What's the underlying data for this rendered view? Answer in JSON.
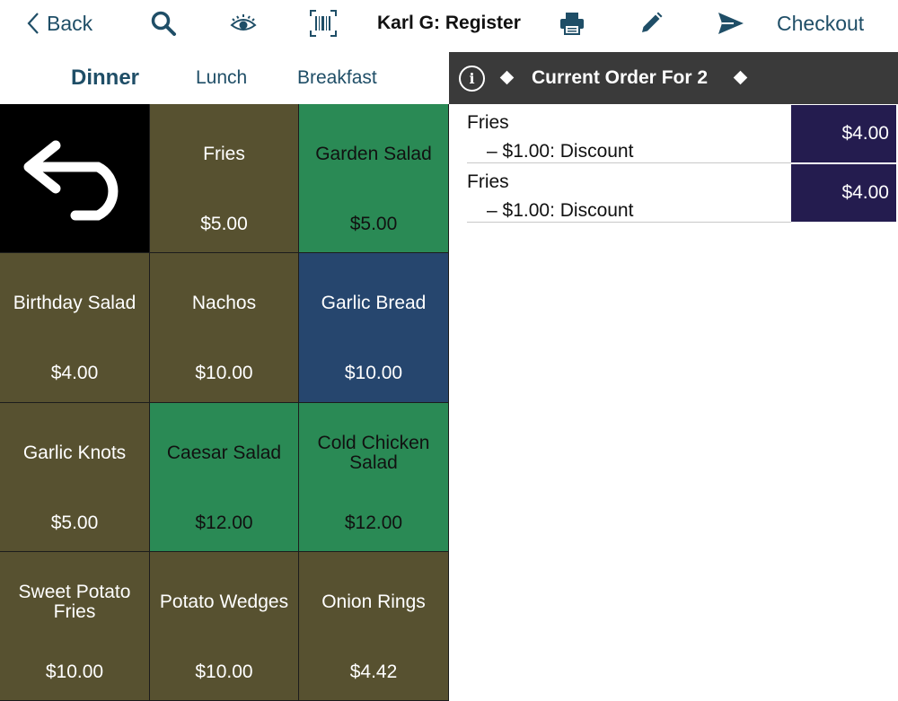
{
  "toolbar": {
    "back_label": "Back",
    "title": "Karl G: Register",
    "checkout_label": "Checkout",
    "icons": [
      "search-icon",
      "eye-icon",
      "barcode-icon",
      "printer-icon",
      "pencil-icon",
      "send-icon"
    ]
  },
  "tabs": [
    {
      "label": "Dinner",
      "active": true
    },
    {
      "label": "Lunch",
      "active": false
    },
    {
      "label": "Breakfast",
      "active": false
    }
  ],
  "order": {
    "title": "Current Order For 2",
    "info_glyph": "i",
    "lines": [
      {
        "name": "Fries",
        "modifier": "– $1.00: Discount",
        "price": "$4.00"
      },
      {
        "name": "Fries",
        "modifier": "– $1.00: Discount",
        "price": "$4.00"
      }
    ]
  },
  "menu_items": [
    {
      "name": "Fries",
      "price": "$5.00",
      "color": "#575130"
    },
    {
      "name": "Garden Salad",
      "price": "$5.00",
      "color": "#2a8a55"
    },
    {
      "name": "Birthday Salad",
      "price": "$4.00",
      "color": "#575130"
    },
    {
      "name": "Nachos",
      "price": "$10.00",
      "color": "#575130"
    },
    {
      "name": "Garlic Bread",
      "price": "$10.00",
      "color": "#26466e"
    },
    {
      "name": "Garlic Knots",
      "price": "$5.00",
      "color": "#575130"
    },
    {
      "name": "Caesar Salad",
      "price": "$12.00",
      "color": "#2a8a55"
    },
    {
      "name": "Cold Chicken Salad",
      "price": "$12.00",
      "color": "#2a8a55"
    },
    {
      "name": "Sweet Potato Fries",
      "price": "$10.00",
      "color": "#575130"
    },
    {
      "name": "Potato Wedges",
      "price": "$10.00",
      "color": "#575130"
    },
    {
      "name": "Onion Rings",
      "price": "$4.42",
      "color": "#575130"
    }
  ],
  "colors": {
    "accent": "#1f4e67",
    "order_header_bg": "#3a3a3a",
    "price_box_bg": "#241c4f"
  }
}
